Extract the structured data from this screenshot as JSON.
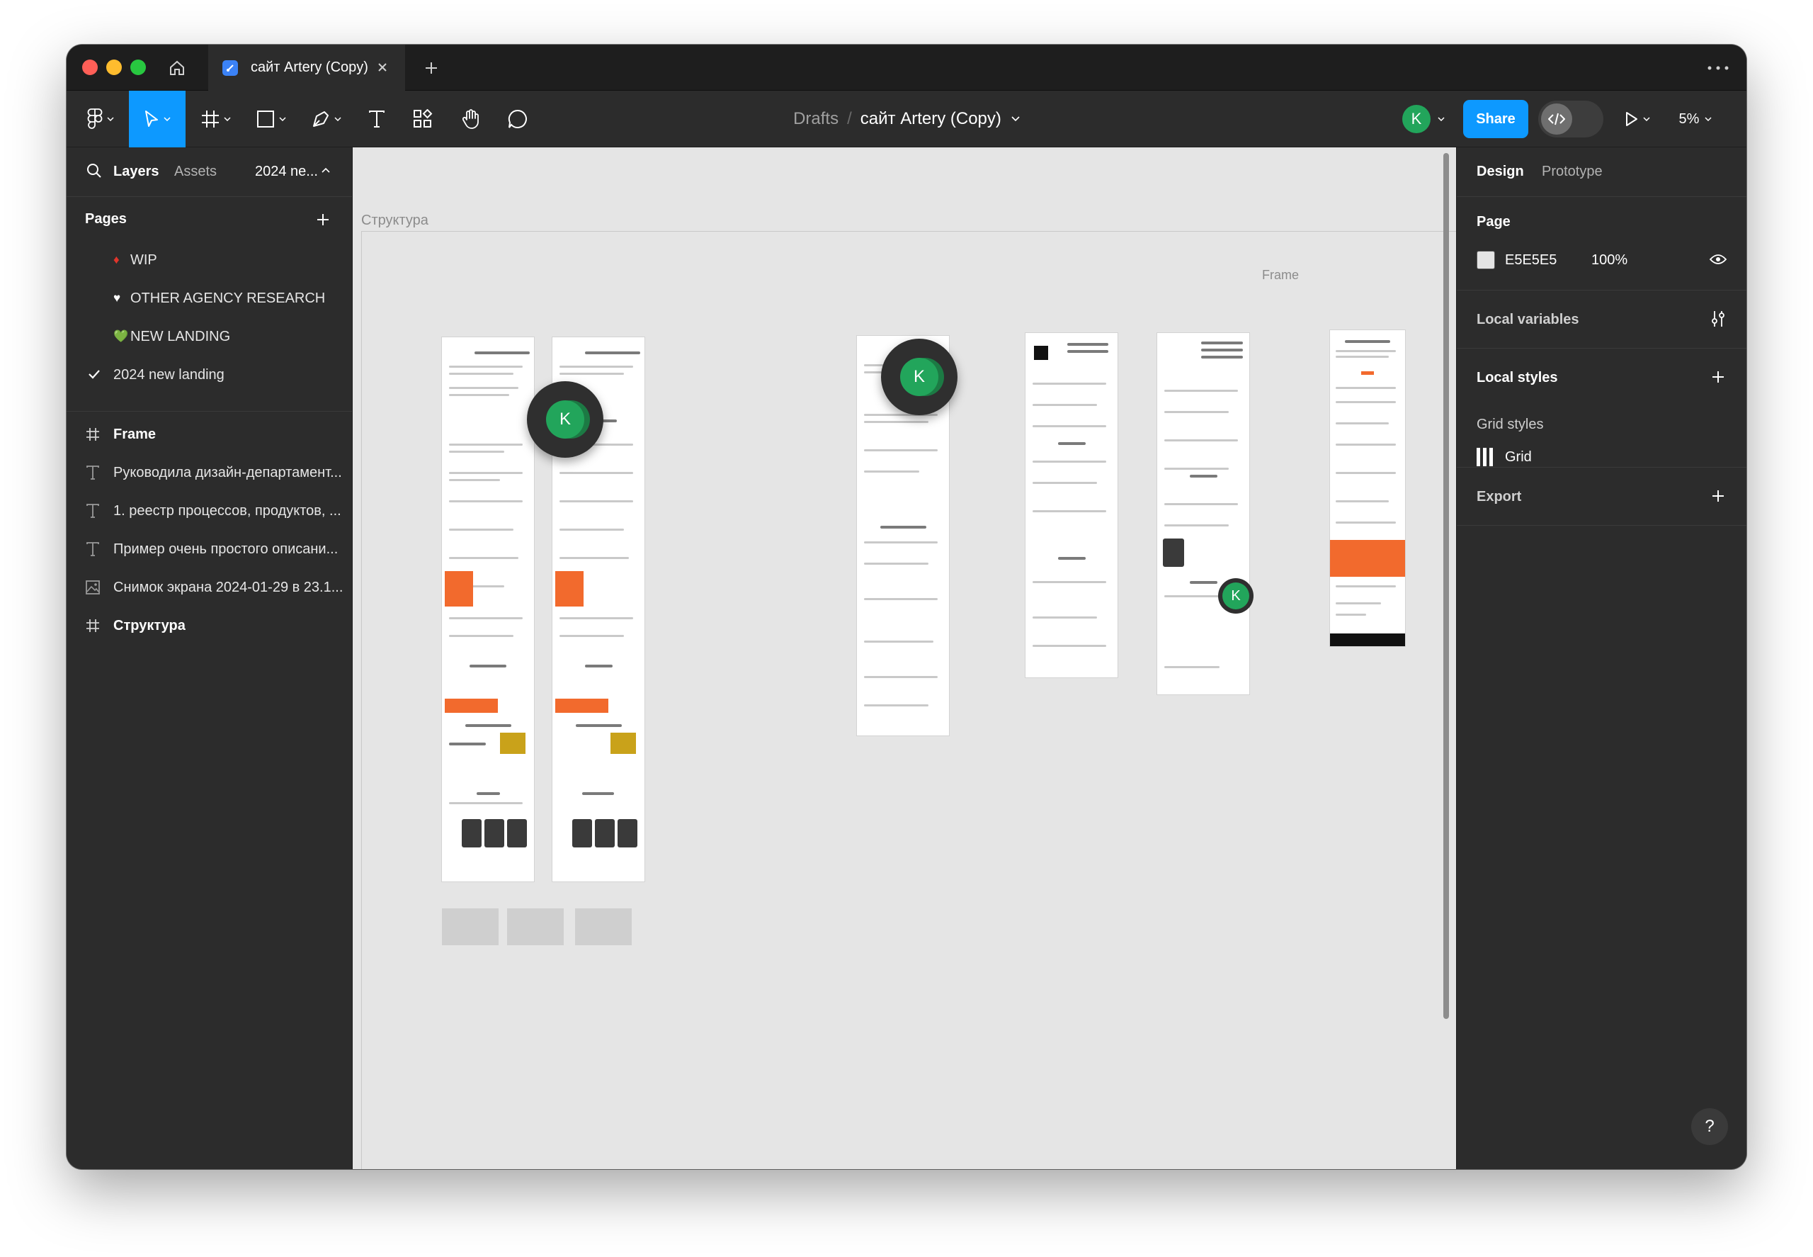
{
  "window": {
    "tab_title": "сайт Artery (Copy)",
    "colors": {
      "accent": "#0d99ff",
      "avatar": "#22a55b",
      "canvas": "#e5e5e5",
      "panel": "#2c2c2c"
    }
  },
  "toolbar": {
    "tools": [
      "figma-menu-icon",
      "move-tool-icon",
      "frame-tool-icon",
      "shape-tool-icon",
      "pen-tool-icon",
      "text-tool-icon",
      "resources-icon",
      "hand-tool-icon",
      "comment-icon"
    ],
    "breadcrumb_drafts": "Drafts",
    "breadcrumb_sep": "/",
    "file_name": "сайт Artery (Copy)",
    "avatar_initial": "K",
    "share_label": "Share",
    "zoom": "5%"
  },
  "left_panel": {
    "tab_layers": "Layers",
    "tab_assets": "Assets",
    "current_page": "2024 ne...",
    "pages_title": "Pages",
    "pages": [
      {
        "emoji": "♦",
        "label": "WIP"
      },
      {
        "emoji": "♥",
        "label": "OTHER AGENCY RESEARCH"
      },
      {
        "emoji": "💚",
        "label": "NEW LANDING"
      },
      {
        "emoji": "",
        "label": "2024 new landing",
        "checked": true
      }
    ],
    "layers": [
      {
        "icon": "frame",
        "label": "Frame",
        "bold": true
      },
      {
        "icon": "text",
        "label": "Руководила дизайн-департамент..."
      },
      {
        "icon": "text",
        "label": "1. реестр процессов, продуктов, ..."
      },
      {
        "icon": "text",
        "label": "Пример очень простого описани..."
      },
      {
        "icon": "image",
        "label": "Снимок экрана 2024-01-29 в 23.1..."
      },
      {
        "icon": "frame",
        "label": "Структура",
        "bold": true
      }
    ]
  },
  "canvas": {
    "section_label": "Структура",
    "frame_label": "Frame",
    "cursor_initial": "K"
  },
  "right_panel": {
    "tab_design": "Design",
    "tab_prototype": "Prototype",
    "page_title": "Page",
    "page_color": "E5E5E5",
    "page_opacity": "100%",
    "local_variables": "Local variables",
    "local_styles": "Local styles",
    "grid_styles": "Grid styles",
    "grid_label": "Grid",
    "export": "Export",
    "help": "?"
  }
}
